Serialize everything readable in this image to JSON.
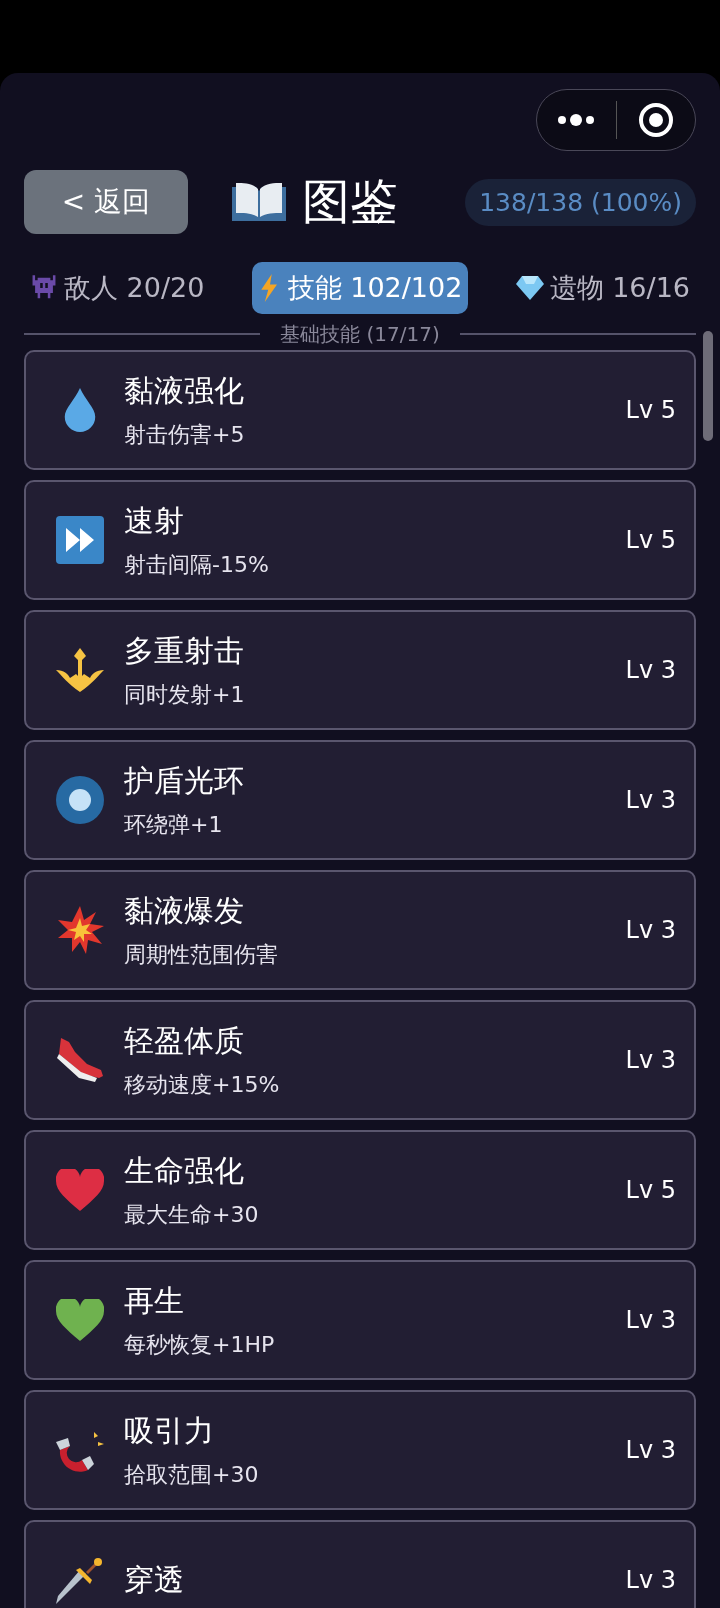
{
  "header": {
    "back_button": "< 返回",
    "title": "图鉴",
    "progress": "138/138 (100%)"
  },
  "tabs": [
    {
      "label": "敌人 20/20",
      "selected": false
    },
    {
      "label": "技能 102/102",
      "selected": true
    },
    {
      "label": "遗物 16/16",
      "selected": false
    }
  ],
  "section": {
    "title": "基础技能 (17/17)"
  },
  "skills": [
    {
      "name": "黏液强化",
      "effect": "射击伤害+5",
      "level": "Lv 5"
    },
    {
      "name": "速射",
      "effect": "射击间隔-15%",
      "level": "Lv 5"
    },
    {
      "name": "多重射击",
      "effect": "同时发射+1",
      "level": "Lv 3"
    },
    {
      "name": "护盾光环",
      "effect": "环绕弹+1",
      "level": "Lv 3"
    },
    {
      "name": "黏液爆发",
      "effect": "周期性范围伤害",
      "level": "Lv 3"
    },
    {
      "name": "轻盈体质",
      "effect": "移动速度+15%",
      "level": "Lv 3"
    },
    {
      "name": "生命强化",
      "effect": "最大生命+30",
      "level": "Lv 5"
    },
    {
      "name": "再生",
      "effect": "每秒恢复+1HP",
      "level": "Lv 3"
    },
    {
      "name": "吸引力",
      "effect": "拾取范围+30",
      "level": "Lv 3"
    },
    {
      "name": "穿透",
      "level": "Lv 3"
    }
  ]
}
